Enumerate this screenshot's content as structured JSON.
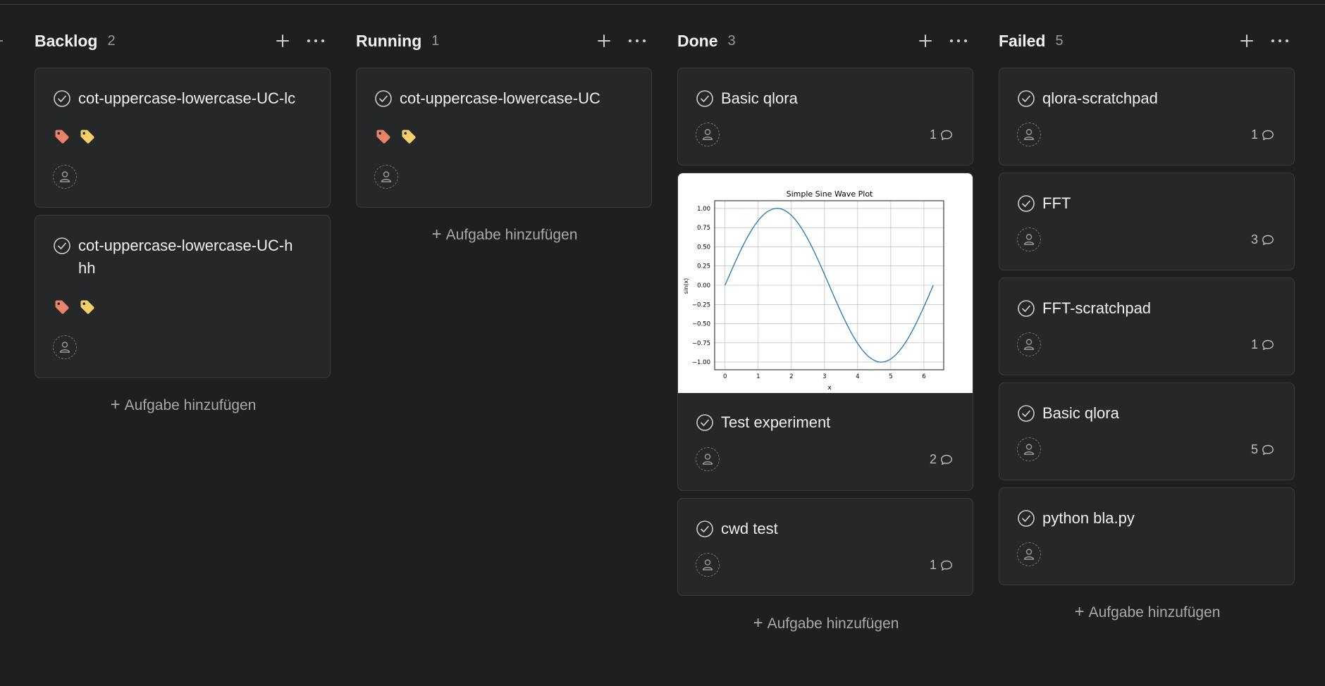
{
  "columns": [
    {
      "title": "Backlog",
      "count": "2",
      "add_label": "Aufgabe hinzufügen",
      "cards": [
        {
          "title": "cot-uppercase-lowercase-UC-lc"
        },
        {
          "title": "cot-uppercase-lowercase-UC-hhh"
        }
      ]
    },
    {
      "title": "Running",
      "count": "1",
      "add_label": "Aufgabe hinzufügen",
      "cards": [
        {
          "title": "cot-uppercase-lowercase-UC"
        }
      ]
    },
    {
      "title": "Done",
      "count": "3",
      "add_label": "Aufgabe hinzufügen",
      "cards": [
        {
          "title": "Basic qlora",
          "comments": "1"
        },
        {
          "title": "Test experiment",
          "comments": "2"
        },
        {
          "title": "cwd test",
          "comments": "1"
        }
      ]
    },
    {
      "title": "Failed",
      "count": "5",
      "add_label": "Aufgabe hinzufügen",
      "cards": [
        {
          "title": "qlora-scratchpad",
          "comments": "1"
        },
        {
          "title": "FFT",
          "comments": "3"
        },
        {
          "title": "FFT-scratchpad",
          "comments": "1"
        },
        {
          "title": "Basic qlora",
          "comments": "5"
        },
        {
          "title": "python bla.py"
        }
      ]
    }
  ],
  "tag_colors": {
    "tag1": "#e8826a",
    "tag2": "#f1d06a"
  },
  "icons": {
    "check": "check-circle-icon",
    "avatar": "person-icon",
    "comment": "comment-bubble-icon",
    "tag": "tag-icon",
    "add": "plus-icon",
    "more": "more-horizontal-icon"
  },
  "chart_data": {
    "type": "line",
    "title": "Simple Sine Wave Plot",
    "xlabel": "x",
    "ylabel": "sin(x)",
    "xlim": [
      0,
      6.2832
    ],
    "ylim": [
      -1.0,
      1.0
    ],
    "xticks": [
      "0",
      "1",
      "2",
      "3",
      "4",
      "5",
      "6"
    ],
    "yticks": [
      "1.00",
      "0.75",
      "0.50",
      "0.25",
      "0.00",
      "−0.25",
      "−0.50",
      "−0.75",
      "−1.00"
    ],
    "grid": true,
    "series": [
      {
        "x": [
          0,
          0.3142,
          0.6283,
          0.9425,
          1.2566,
          1.5708,
          1.885,
          2.1991,
          2.5133,
          2.8274,
          3.1416,
          3.4558,
          3.7699,
          4.0841,
          4.3982,
          4.7124,
          5.0265,
          5.3407,
          5.6549,
          5.969,
          6.2832
        ],
        "values": [
          0,
          0.309,
          0.5878,
          0.809,
          0.9511,
          1.0,
          0.9511,
          0.809,
          0.5878,
          0.309,
          0,
          -0.309,
          -0.5878,
          -0.809,
          -0.9511,
          -1.0,
          -0.9511,
          -0.809,
          -0.5878,
          -0.309,
          0
        ],
        "color": "#1f77b4"
      }
    ]
  }
}
